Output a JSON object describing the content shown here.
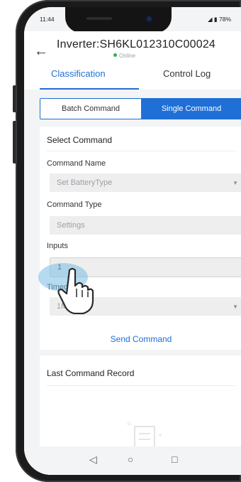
{
  "status_bar": {
    "time": "11:44",
    "battery": "78%"
  },
  "header": {
    "back_icon": "arrow-left-icon",
    "title": "Inverter:SH6KL012310C00024",
    "status": "Online",
    "status_color": "#2fb24a"
  },
  "tabs": {
    "classification": "Classification",
    "control_log": "Control Log"
  },
  "segment": {
    "batch": "Batch Command",
    "single": "Single Command",
    "accent": "#1f6fd6"
  },
  "form": {
    "section_title": "Select Command",
    "command_name_label": "Command Name",
    "command_name_value": "Set BatteryType",
    "command_type_label": "Command Type",
    "command_type_value": "Settings",
    "inputs_label": "Inputs",
    "inputs_value": "1",
    "timeout_label": "Timeout",
    "timeout_value": "1Minute",
    "send_label": "Send Command"
  },
  "record": {
    "title": "Last Command Record"
  },
  "nav": {
    "back": "◁",
    "home": "○",
    "recent": "□"
  }
}
